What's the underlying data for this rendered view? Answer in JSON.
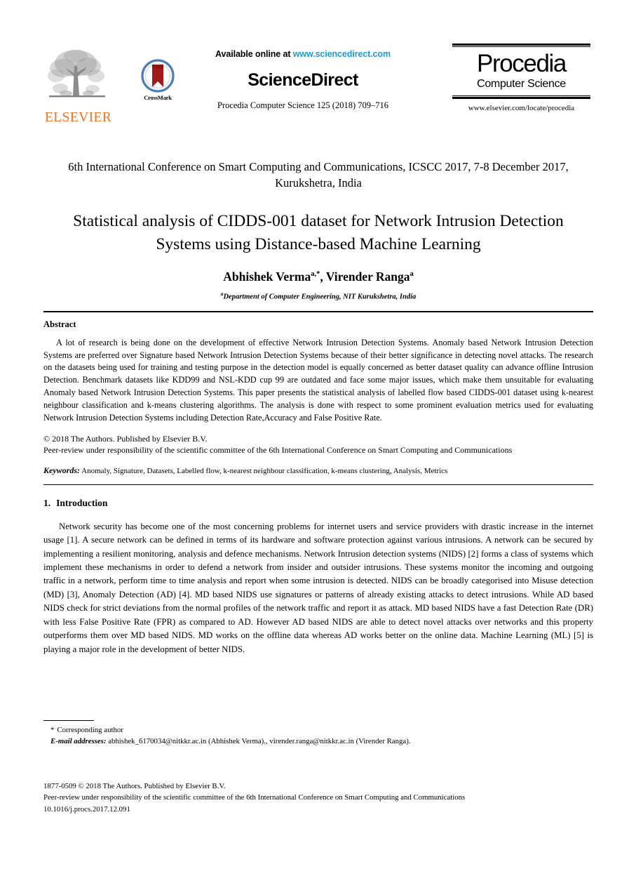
{
  "masthead": {
    "elsevier_wordmark": "ELSEVIER",
    "elsevier_logo_alt": "elsevier-tree-logo",
    "crossmark_label": "CrossMark",
    "available_prefix": "Available online at ",
    "available_url": "www.sciencedirect.com",
    "sciencedirect_title": "ScienceDirect",
    "journal_citation": "Procedia Computer Science 125 (2018) 709–716",
    "procedia_name": "Procedia",
    "procedia_subtitle": "Computer Science",
    "procedia_url": "www.elsevier.com/locate/procedia"
  },
  "conference": "6th International Conference on Smart Computing and Communications, ICSCC 2017, 7-8 December 2017, Kurukshetra, India",
  "title": "Statistical analysis of CIDDS-001 dataset for Network Intrusion Detection Systems using Distance-based Machine Learning",
  "authors": {
    "author1_name": "Abhishek Verma",
    "author1_sup": "a,*",
    "separator": ", ",
    "author2_name": "Virender Ranga",
    "author2_sup": "a"
  },
  "affiliation": {
    "marker": "a",
    "text": "Department of Computer Engineering, NIT Kurukshetra, India"
  },
  "abstract": {
    "heading": "Abstract",
    "text": "A lot of research is being done on the development of effective Network Intrusion Detection Systems. Anomaly based Network Intrusion Detection Systems are preferred over Signature based Network Intrusion Detection Systems because of their better significance in detecting novel attacks. The research on the datasets being used for training and testing purpose in the detection model is equally concerned as better dataset quality can advance offline Intrusion Detection. Benchmark datasets like KDD99 and NSL-KDD cup 99 are outdated and face some major issues, which make them unsuitable for evaluating Anomaly based Network Intrusion Detection Systems. This paper presents the statistical analysis of labelled flow based CIDDS-001 dataset using k-nearest neighbour classification and k-means clustering algorithms. The analysis is done with respect to some prominent evaluation metrics used for evaluating Network Intrusion Detection Systems including Detection Rate,Accuracy and False Positive Rate."
  },
  "copyright": {
    "line1": "© 2018 The Authors. Published by Elsevier B.V.",
    "line2": "Peer-review under responsibility of the scientific committee of the 6th International Conference on Smart Computing and Communications"
  },
  "keywords": {
    "label": "Keywords:",
    "text": "Anomaly, Signature, Datasets, Labelled flow, k-nearest neighbour classification, k-means clustering, Analysis, Metrics"
  },
  "introduction": {
    "number": "1.",
    "heading": "Introduction",
    "paragraph": "Network security has become one of the most concerning problems for internet users and service providers with drastic increase in the internet usage [1]. A secure network can be defined in terms of its hardware and software protection against various intrusions. A network can be secured by implementing a resilient monitoring, analysis and defence mechanisms. Network Intrusion detection systems (NIDS) [2] forms a class of systems which implement these mechanisms in order to defend a network from insider and outsider intrusions. These systems monitor the incoming and outgoing traffic in a network, perform time to time analysis and report when some intrusion is detected. NIDS can be broadly categorised into Misuse detection (MD) [3], Anomaly Detection (AD) [4]. MD based NIDS use signatures or patterns of already existing attacks to detect intrusions. While AD based NIDS check for strict deviations from the normal profiles of the network traffic and report it as attack. MD based NIDS have a fast Detection Rate (DR) with less False Positive Rate (FPR) as compared to AD. However AD based NIDS are able to detect novel attacks over networks and this property outperforms them over MD based NIDS. MD works on the offline data whereas AD works better on the online data. Machine Learning (ML) [5] is playing a major role in the development of better NIDS."
  },
  "footnote": {
    "star": "*",
    "corresponding": "Corresponding author",
    "email_label": "E-mail addresses:",
    "email_text": "abhishek_6170034@nitkkr.ac.in (Abhishek Verma)., virender.ranga@nitkkr.ac.in (Virender Ranga)."
  },
  "bottom": {
    "line1": "1877-0509 © 2018 The Authors. Published by Elsevier B.V.",
    "line2": "Peer-review under responsibility of the scientific committee of the 6th International Conference on Smart Computing and Communications",
    "line3": "10.1016/j.procs.2017.12.091"
  },
  "colors": {
    "elsevier_orange": "#e87722",
    "link_blue": "#1b9ad6",
    "crossmark_red": "#a11b1b",
    "crossmark_blue": "#4a7ebb"
  }
}
